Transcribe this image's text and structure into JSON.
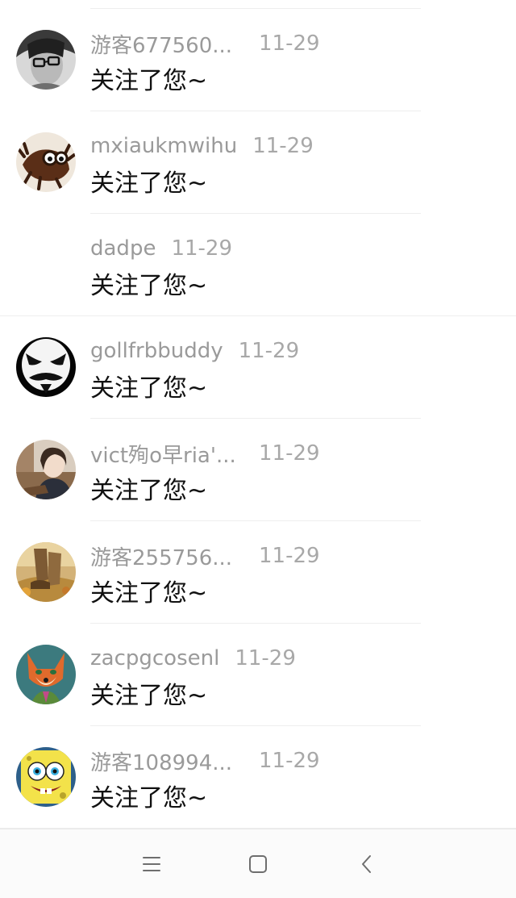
{
  "notifications": [
    {
      "name": "游客677560...",
      "date": "11-29",
      "message": "关注了您~",
      "avatar": "bw-glasses-avatar"
    },
    {
      "name": "mxiaukmwihu",
      "date": "11-29",
      "message": "关注了您~",
      "avatar": "owl-sketch-avatar"
    },
    {
      "name": "dadpe",
      "date": "11-29",
      "message": "关注了您~",
      "avatar": ""
    },
    {
      "name": "gollfrbbuddy",
      "date": "11-29",
      "message": "关注了您~",
      "avatar": "mask-face-avatar"
    },
    {
      "name": "vict殉o早ria'...",
      "date": "11-29",
      "message": "关注了您~",
      "avatar": "girl-photo-avatar"
    },
    {
      "name": "游客255756...",
      "date": "11-29",
      "message": "关注了您~",
      "avatar": "autumn-boots-avatar"
    },
    {
      "name": "zacpgcosenl",
      "date": "11-29",
      "message": "关注了您~",
      "avatar": "fox-cartoon-avatar"
    },
    {
      "name": "游客108994...",
      "date": "11-29",
      "message": "关注了您~",
      "avatar": "sponge-cartoon-avatar"
    }
  ],
  "navbar": {
    "icons": [
      "menu-icon",
      "home-square-icon",
      "back-chevron-icon"
    ]
  },
  "colors": {
    "name_text": "#9a9a9a",
    "message_text": "#111111",
    "divider": "#eeeeee"
  }
}
